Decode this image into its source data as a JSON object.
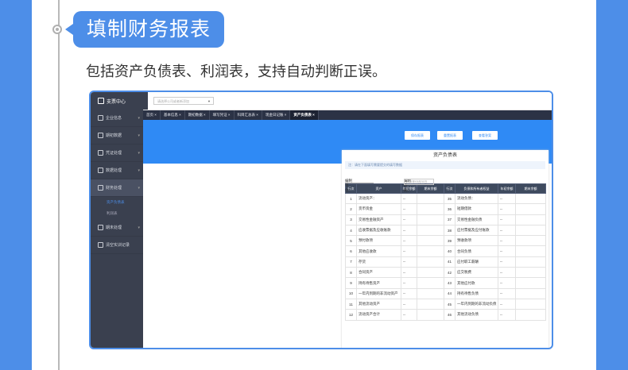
{
  "section": {
    "title": "填制财务报表",
    "description": "包括资产负债表、利润表，支持自动判断正误。"
  },
  "app": {
    "logo": "支票中心",
    "company_select_placeholder": "请选择公司或者新添加",
    "nav": [
      {
        "label": "企业信息",
        "icon": "building-icon",
        "has_chevron": true
      },
      {
        "label": "期初数据",
        "icon": "chart-icon",
        "has_chevron": true
      },
      {
        "label": "凭证处理",
        "icon": "doc-icon",
        "has_chevron": true
      },
      {
        "label": "数据处理",
        "icon": "data-icon",
        "has_chevron": true
      },
      {
        "label": "财务处理",
        "icon": "trend-icon",
        "has_chevron": true,
        "active": true
      },
      {
        "label": "期末处理",
        "icon": "folder-icon",
        "has_chevron": true
      },
      {
        "label": "清空实训记录",
        "icon": "rocket-icon",
        "has_chevron": false
      }
    ],
    "subnav": [
      "资产负债表",
      "利润表"
    ],
    "tabs": [
      "首页 ×",
      "基本信息 ×",
      "期初数据 ×",
      "填写凭证 ×",
      "科目汇总表 ×",
      "现金日记账 ×",
      "资产负债表 ×"
    ],
    "buttons": {
      "save": "保存报表",
      "reset": "重置报表",
      "view": "查看答案"
    },
    "report": {
      "title": "资产负债表",
      "tip": "注：请在下面填写需要提交的填写数据",
      "unit_label": "编制单位：",
      "date_label": "编制日期：",
      "date_value": "2021年03月31日",
      "headers": [
        "行次",
        "资产",
        "年初余额",
        "期末余额",
        "行次",
        "负债和所有者权益",
        "年初余额",
        "期末余额"
      ],
      "rows": [
        [
          "1",
          "流动资产：",
          "--",
          "",
          "35",
          "流动负债：",
          "--",
          ""
        ],
        [
          "2",
          "货币资金",
          "--",
          "",
          "36",
          "短期借款",
          "--",
          ""
        ],
        [
          "3",
          "交易性金融资产",
          "--",
          "",
          "37",
          "交易性金融负债",
          "--",
          ""
        ],
        [
          "4",
          "应收票据及应收账款",
          "--",
          "",
          "38",
          "应付票据及应付账款",
          "--",
          ""
        ],
        [
          "5",
          "预付款项",
          "--",
          "",
          "39",
          "预收款项",
          "--",
          ""
        ],
        [
          "6",
          "其他应收款",
          "--",
          "",
          "40",
          "合同负债",
          "--",
          ""
        ],
        [
          "7",
          "存货",
          "--",
          "",
          "41",
          "应付职工薪酬",
          "--",
          ""
        ],
        [
          "8",
          "合同资产",
          "--",
          "",
          "42",
          "应交税费",
          "--",
          ""
        ],
        [
          "9",
          "持有待售资产",
          "--",
          "",
          "43",
          "其他应付款",
          "--",
          ""
        ],
        [
          "10",
          "一年内到期的非流动资产",
          "--",
          "",
          "44",
          "持有待售负债",
          "--",
          ""
        ],
        [
          "11",
          "其他流动资产",
          "--",
          "",
          "45",
          "一年内到期的非流动负债",
          "--",
          ""
        ],
        [
          "12",
          "流动资产合计",
          "--",
          "",
          "46",
          "其他流动负债",
          "--",
          ""
        ]
      ]
    }
  }
}
